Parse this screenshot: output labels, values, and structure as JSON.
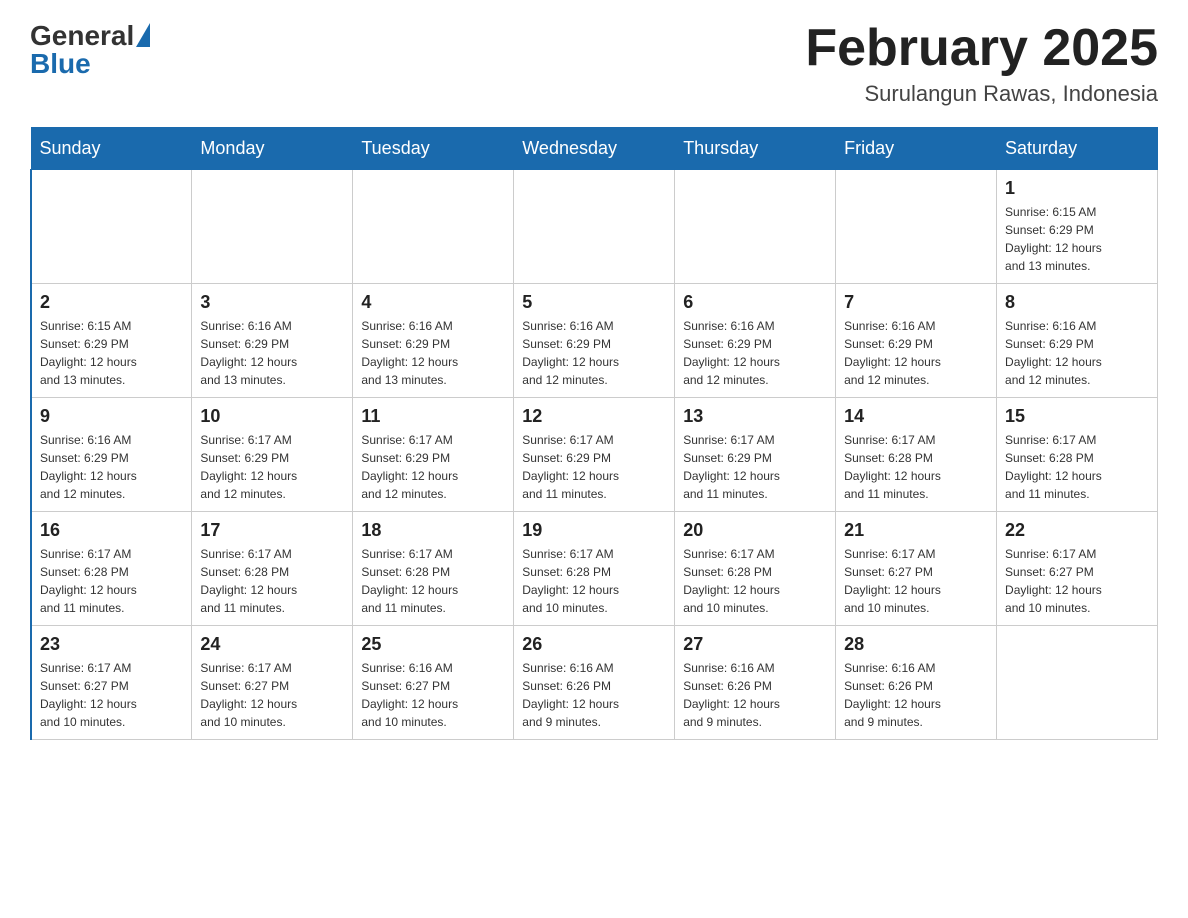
{
  "logo": {
    "text_general": "General",
    "text_blue": "Blue"
  },
  "title": "February 2025",
  "subtitle": "Surulangun Rawas, Indonesia",
  "days_of_week": [
    "Sunday",
    "Monday",
    "Tuesday",
    "Wednesday",
    "Thursday",
    "Friday",
    "Saturday"
  ],
  "weeks": [
    {
      "cells": [
        {
          "day": "",
          "info": ""
        },
        {
          "day": "",
          "info": ""
        },
        {
          "day": "",
          "info": ""
        },
        {
          "day": "",
          "info": ""
        },
        {
          "day": "",
          "info": ""
        },
        {
          "day": "",
          "info": ""
        },
        {
          "day": "1",
          "info": "Sunrise: 6:15 AM\nSunset: 6:29 PM\nDaylight: 12 hours\nand 13 minutes."
        }
      ]
    },
    {
      "cells": [
        {
          "day": "2",
          "info": "Sunrise: 6:15 AM\nSunset: 6:29 PM\nDaylight: 12 hours\nand 13 minutes."
        },
        {
          "day": "3",
          "info": "Sunrise: 6:16 AM\nSunset: 6:29 PM\nDaylight: 12 hours\nand 13 minutes."
        },
        {
          "day": "4",
          "info": "Sunrise: 6:16 AM\nSunset: 6:29 PM\nDaylight: 12 hours\nand 13 minutes."
        },
        {
          "day": "5",
          "info": "Sunrise: 6:16 AM\nSunset: 6:29 PM\nDaylight: 12 hours\nand 12 minutes."
        },
        {
          "day": "6",
          "info": "Sunrise: 6:16 AM\nSunset: 6:29 PM\nDaylight: 12 hours\nand 12 minutes."
        },
        {
          "day": "7",
          "info": "Sunrise: 6:16 AM\nSunset: 6:29 PM\nDaylight: 12 hours\nand 12 minutes."
        },
        {
          "day": "8",
          "info": "Sunrise: 6:16 AM\nSunset: 6:29 PM\nDaylight: 12 hours\nand 12 minutes."
        }
      ]
    },
    {
      "cells": [
        {
          "day": "9",
          "info": "Sunrise: 6:16 AM\nSunset: 6:29 PM\nDaylight: 12 hours\nand 12 minutes."
        },
        {
          "day": "10",
          "info": "Sunrise: 6:17 AM\nSunset: 6:29 PM\nDaylight: 12 hours\nand 12 minutes."
        },
        {
          "day": "11",
          "info": "Sunrise: 6:17 AM\nSunset: 6:29 PM\nDaylight: 12 hours\nand 12 minutes."
        },
        {
          "day": "12",
          "info": "Sunrise: 6:17 AM\nSunset: 6:29 PM\nDaylight: 12 hours\nand 11 minutes."
        },
        {
          "day": "13",
          "info": "Sunrise: 6:17 AM\nSunset: 6:29 PM\nDaylight: 12 hours\nand 11 minutes."
        },
        {
          "day": "14",
          "info": "Sunrise: 6:17 AM\nSunset: 6:28 PM\nDaylight: 12 hours\nand 11 minutes."
        },
        {
          "day": "15",
          "info": "Sunrise: 6:17 AM\nSunset: 6:28 PM\nDaylight: 12 hours\nand 11 minutes."
        }
      ]
    },
    {
      "cells": [
        {
          "day": "16",
          "info": "Sunrise: 6:17 AM\nSunset: 6:28 PM\nDaylight: 12 hours\nand 11 minutes."
        },
        {
          "day": "17",
          "info": "Sunrise: 6:17 AM\nSunset: 6:28 PM\nDaylight: 12 hours\nand 11 minutes."
        },
        {
          "day": "18",
          "info": "Sunrise: 6:17 AM\nSunset: 6:28 PM\nDaylight: 12 hours\nand 11 minutes."
        },
        {
          "day": "19",
          "info": "Sunrise: 6:17 AM\nSunset: 6:28 PM\nDaylight: 12 hours\nand 10 minutes."
        },
        {
          "day": "20",
          "info": "Sunrise: 6:17 AM\nSunset: 6:28 PM\nDaylight: 12 hours\nand 10 minutes."
        },
        {
          "day": "21",
          "info": "Sunrise: 6:17 AM\nSunset: 6:27 PM\nDaylight: 12 hours\nand 10 minutes."
        },
        {
          "day": "22",
          "info": "Sunrise: 6:17 AM\nSunset: 6:27 PM\nDaylight: 12 hours\nand 10 minutes."
        }
      ]
    },
    {
      "cells": [
        {
          "day": "23",
          "info": "Sunrise: 6:17 AM\nSunset: 6:27 PM\nDaylight: 12 hours\nand 10 minutes."
        },
        {
          "day": "24",
          "info": "Sunrise: 6:17 AM\nSunset: 6:27 PM\nDaylight: 12 hours\nand 10 minutes."
        },
        {
          "day": "25",
          "info": "Sunrise: 6:16 AM\nSunset: 6:27 PM\nDaylight: 12 hours\nand 10 minutes."
        },
        {
          "day": "26",
          "info": "Sunrise: 6:16 AM\nSunset: 6:26 PM\nDaylight: 12 hours\nand 9 minutes."
        },
        {
          "day": "27",
          "info": "Sunrise: 6:16 AM\nSunset: 6:26 PM\nDaylight: 12 hours\nand 9 minutes."
        },
        {
          "day": "28",
          "info": "Sunrise: 6:16 AM\nSunset: 6:26 PM\nDaylight: 12 hours\nand 9 minutes."
        },
        {
          "day": "",
          "info": ""
        }
      ]
    }
  ]
}
